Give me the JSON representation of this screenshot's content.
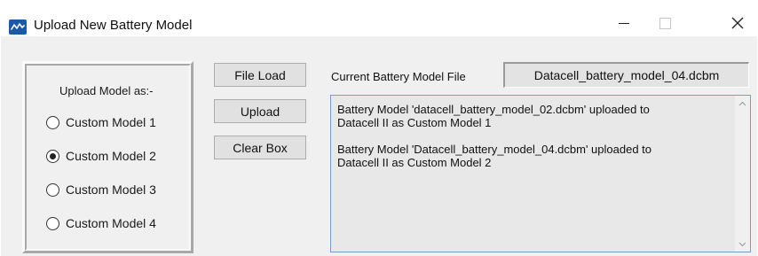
{
  "window": {
    "title": "Upload New Battery Model",
    "app_icon": "waveform-icon",
    "controls": {
      "minimize": "minimize",
      "maximize": "maximize",
      "close": "close"
    }
  },
  "model_group": {
    "title": "Upload Model as:-",
    "selected": "Custom Model 2",
    "options": [
      {
        "label": "Custom Model 1",
        "checked": false
      },
      {
        "label": "Custom Model 2",
        "checked": true
      },
      {
        "label": "Custom Model 3",
        "checked": false
      },
      {
        "label": "Custom Model 4",
        "checked": false
      }
    ]
  },
  "buttons": {
    "file_load": "File Load",
    "upload": "Upload",
    "clear_box": "Clear Box"
  },
  "current_file": {
    "label": "Current Battery Model File",
    "value": "Datacell_battery_model_04.dcbm"
  },
  "log": {
    "text": "Battery Model 'datacell_battery_model_02.dcbm' uploaded to\nDatacell II as Custom Model 1\n\nBattery Model 'Datacell_battery_model_04.dcbm' uploaded to\nDatacell II as Custom Model 2"
  },
  "colors": {
    "dialog_bg": "#f0f0f0",
    "log_border": "#7a9cc6",
    "icon_bg": "#1a5aa8"
  }
}
